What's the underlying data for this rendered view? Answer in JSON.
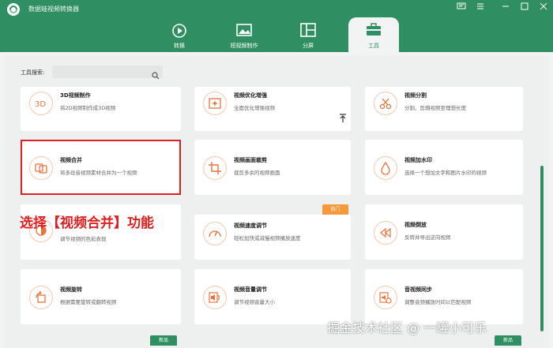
{
  "app": {
    "title": "数据蛙视频转换器",
    "accent": "#2f8f62"
  },
  "window_controls": [
    "message-icon",
    "menu-icon",
    "minimize-icon",
    "maximize-icon",
    "close-icon"
  ],
  "tabs": [
    {
      "label": "转换",
      "icon": "convert-icon",
      "active": false
    },
    {
      "label": "短视频制作",
      "icon": "short-video-icon",
      "active": false
    },
    {
      "label": "分屏",
      "icon": "split-screen-icon",
      "active": false
    },
    {
      "label": "工具",
      "icon": "toolbox-icon",
      "active": true
    }
  ],
  "search": {
    "label": "工具搜索:",
    "value": ""
  },
  "cards": [
    {
      "title": "3D视频制作",
      "desc": "将2D视频制作成3D视频",
      "icon": "3d-icon"
    },
    {
      "title": "视频优化增强",
      "desc": "全面优化增强视频",
      "icon": "enhance-icon"
    },
    {
      "title": "视频分割",
      "desc": "分割、剪辑视频至理想长度",
      "icon": "scissors-icon"
    },
    {
      "title": "视频合并",
      "desc": "将多段音视频素材合并为一个视频",
      "icon": "merge-icon"
    },
    {
      "title": "视频画面裁剪",
      "desc": "裁剪多余的视频画面",
      "icon": "crop-icon"
    },
    {
      "title": "视频加水印",
      "desc": "选择一个想加文字和图片水印的视频",
      "icon": "watermark-drop-icon"
    },
    {
      "title": "",
      "desc": "调节视频的色彩表现",
      "icon": "color-icon"
    },
    {
      "title": "视频速度调节",
      "desc": "轻松加快或减慢视频播放速度",
      "icon": "speed-icon"
    },
    {
      "title": "视频倒放",
      "desc": "反转并导出逆向视频",
      "icon": "rewind-icon"
    },
    {
      "title": "视频旋转",
      "desc": "根据需要旋转或翻转视频",
      "icon": "rotate-icon"
    },
    {
      "title": "视频音量调节",
      "desc": "调节视频音量大小",
      "icon": "volume-icon"
    },
    {
      "title": "音视频同步",
      "desc": "调整音频播放时间以匹配视频",
      "icon": "sync-icon"
    }
  ],
  "badges": {
    "hot": "热门",
    "new": "新品"
  },
  "overlay_text": "选择【视频合并】功能",
  "watermark": "掘金技术社区 @ 一罐小可乐"
}
